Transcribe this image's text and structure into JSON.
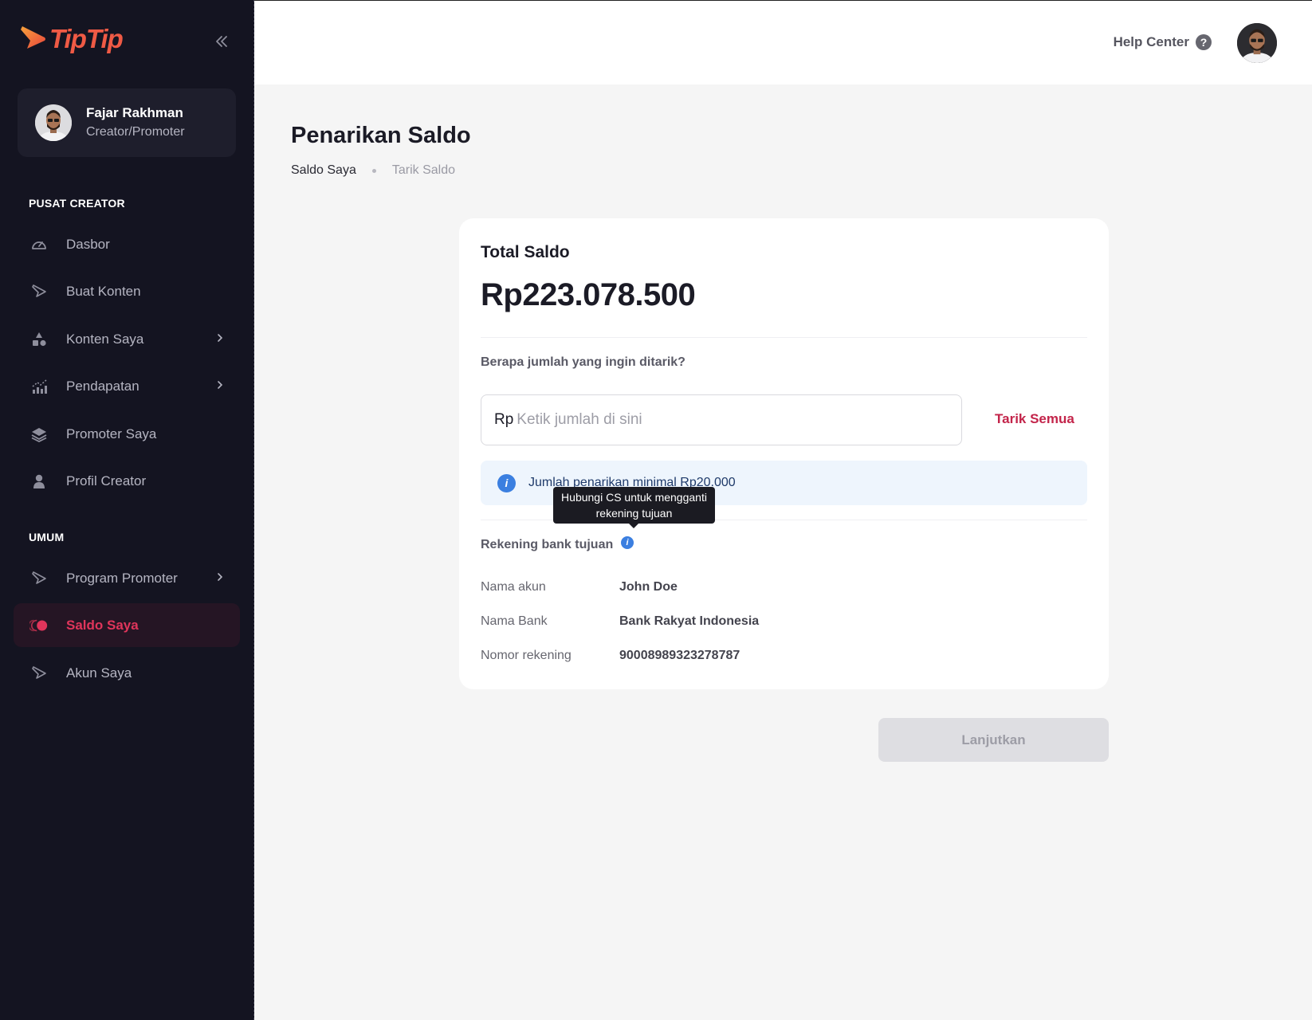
{
  "brand": {
    "name": "TipTip",
    "logo_icon": "play-arrow-logo",
    "color": "#ef5a45"
  },
  "sidebar": {
    "collapse_icon": "double-chevron-left-icon",
    "profile": {
      "name": "Fajar Rakhman",
      "role": "Creator/Promoter"
    },
    "sections": [
      {
        "label": "PUSAT CREATOR",
        "items": [
          {
            "label": "Dasbor",
            "icon": "gauge-icon",
            "has_submenu": false
          },
          {
            "label": "Buat Konten",
            "icon": "play-outline-icon",
            "has_submenu": false
          },
          {
            "label": "Konten Saya",
            "icon": "shapes-icon",
            "has_submenu": true
          },
          {
            "label": "Pendapatan",
            "icon": "bar-chart-icon",
            "has_submenu": true
          },
          {
            "label": "Promoter Saya",
            "icon": "layers-icon",
            "has_submenu": false
          },
          {
            "label": "Profil Creator",
            "icon": "person-icon",
            "has_submenu": false
          }
        ]
      },
      {
        "label": "UMUM",
        "items": [
          {
            "label": "Program Promoter",
            "icon": "play-outline-icon",
            "has_submenu": true
          },
          {
            "label": "Saldo Saya",
            "icon": "coins-icon",
            "has_submenu": false,
            "active": true
          },
          {
            "label": "Akun Saya",
            "icon": "play-outline-icon",
            "has_submenu": false
          }
        ]
      }
    ],
    "active_color": "#e0355b"
  },
  "topbar": {
    "help_label": "Help Center",
    "help_icon": "question-circle-icon"
  },
  "page": {
    "title": "Penarikan Saldo",
    "breadcrumb": [
      "Saldo Saya",
      "Tarik Saldo"
    ]
  },
  "card": {
    "total_label": "Total Saldo",
    "total_amount": "Rp223.078.500",
    "question": "Berapa jumlah yang ingin ditarik?",
    "input_prefix": "Rp",
    "input_placeholder": "Ketik jumlah di sini",
    "input_value": "",
    "withdraw_all_label": "Tarik Semua",
    "info_text": "Jumlah penarikan minimal Rp20.000",
    "bank_section_title": "Rekening bank tujuan",
    "tooltip_text": "Hubungi CS untuk mengganti rekening tujuan",
    "bank_rows": [
      {
        "key": "Nama akun",
        "value": "John Doe"
      },
      {
        "key": "Nama Bank",
        "value": "Bank Rakyat Indonesia"
      },
      {
        "key": "Nomor rekening",
        "value": "90008989323278787"
      }
    ]
  },
  "actions": {
    "continue_label": "Lanjutkan",
    "continue_enabled": false
  },
  "colors": {
    "sidebar_bg": "#141421",
    "accent": "#c3244a",
    "info_blue": "#3b7fe0",
    "page_bg": "#f5f5f5"
  }
}
